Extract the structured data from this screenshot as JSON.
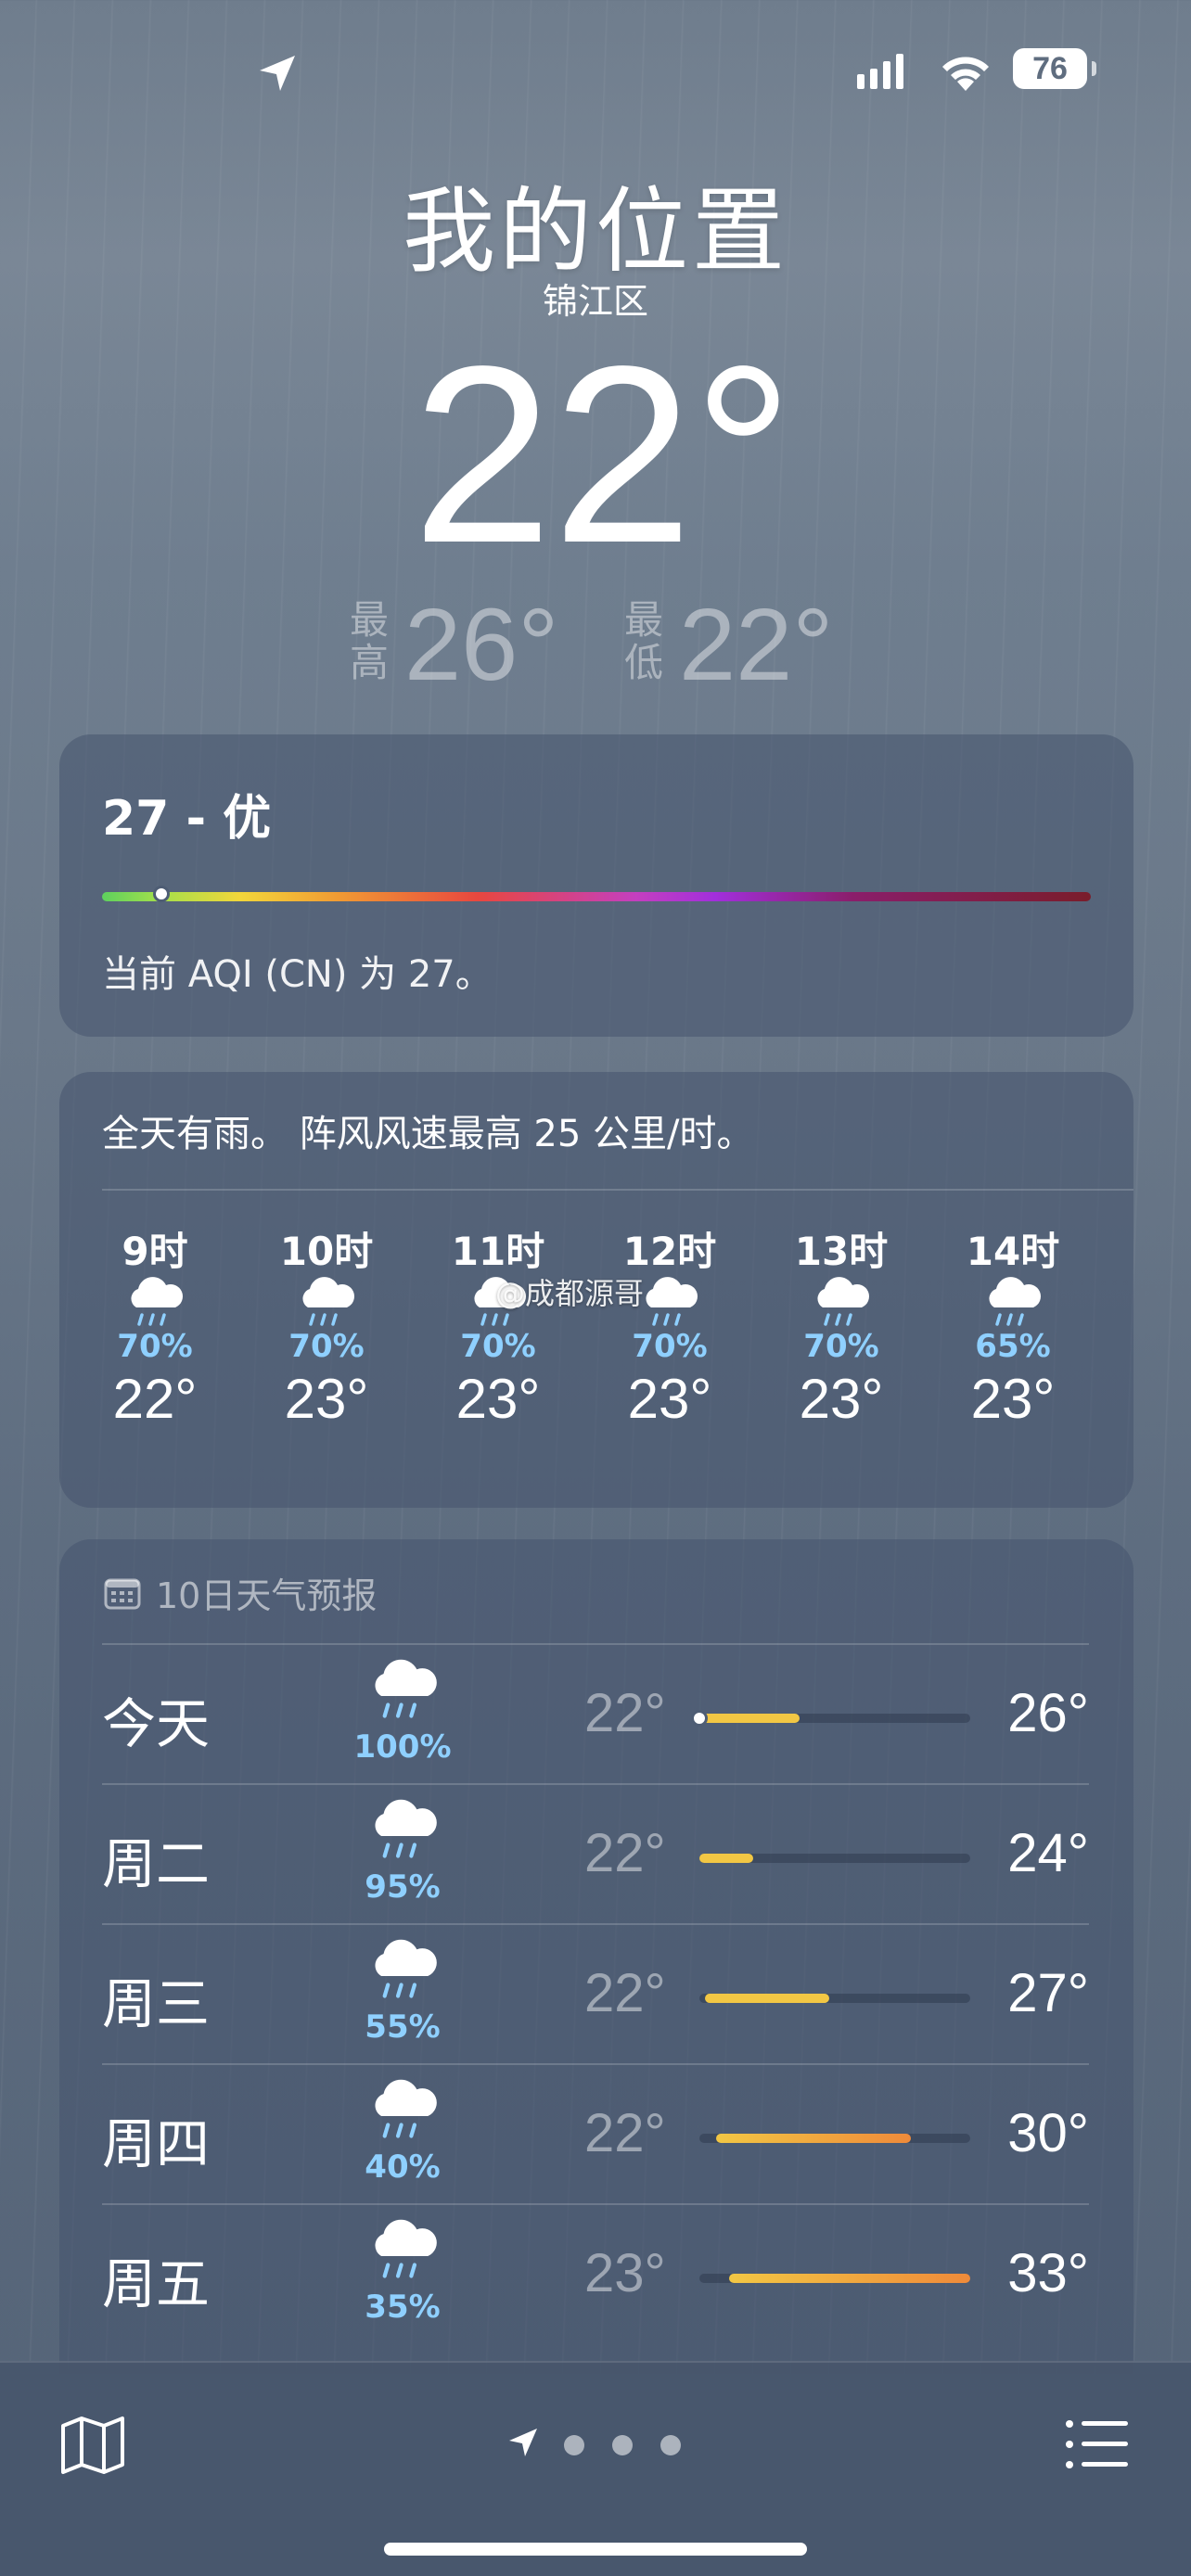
{
  "status_bar": {
    "battery": "76"
  },
  "header": {
    "place": "我的位置",
    "district": "锦江区",
    "temperature": "22°",
    "high_label": "最高",
    "high": "26°",
    "low_label": "最低",
    "low": "22°"
  },
  "aqi": {
    "value_label": "27 - 优",
    "description": "当前 AQI (CN) 为 27。",
    "scale_position": 0.06
  },
  "hourly": {
    "summary": "全天有雨。 阵风风速最高 25 公里/时。",
    "items": [
      {
        "time": "9时",
        "icon": "rain-cloud-icon",
        "precip": "70%",
        "temp": "22°"
      },
      {
        "time": "10时",
        "icon": "rain-cloud-icon",
        "precip": "70%",
        "temp": "23°"
      },
      {
        "time": "11时",
        "icon": "rain-cloud-icon",
        "precip": "70%",
        "temp": "23°"
      },
      {
        "time": "12时",
        "icon": "rain-cloud-icon",
        "precip": "70%",
        "temp": "23°"
      },
      {
        "time": "13时",
        "icon": "rain-cloud-icon",
        "precip": "70%",
        "temp": "23°"
      },
      {
        "time": "14时",
        "icon": "rain-cloud-icon",
        "precip": "65%",
        "temp": "23°"
      }
    ]
  },
  "watermark": "@成都源哥",
  "forecast": {
    "title": "10日天气预报",
    "days": [
      {
        "day": "今天",
        "precip": "100%",
        "low": "22°",
        "high": "26°",
        "range_start": 0.0,
        "range_end": 0.37,
        "current": 0.0
      },
      {
        "day": "周二",
        "precip": "95%",
        "low": "22°",
        "high": "24°",
        "range_start": 0.0,
        "range_end": 0.2
      },
      {
        "day": "周三",
        "precip": "55%",
        "low": "22°",
        "high": "27°",
        "range_start": 0.02,
        "range_end": 0.48
      },
      {
        "day": "周四",
        "precip": "40%",
        "low": "22°",
        "high": "30°",
        "range_start": 0.06,
        "range_end": 0.78
      },
      {
        "day": "周五",
        "precip": "35%",
        "low": "23°",
        "high": "33°",
        "range_start": 0.11,
        "range_end": 1.0
      }
    ]
  },
  "colors": {
    "precip": "#8fd0ff",
    "bar_cool": "#f2c744",
    "bar_warm": "#ef8a3a"
  }
}
